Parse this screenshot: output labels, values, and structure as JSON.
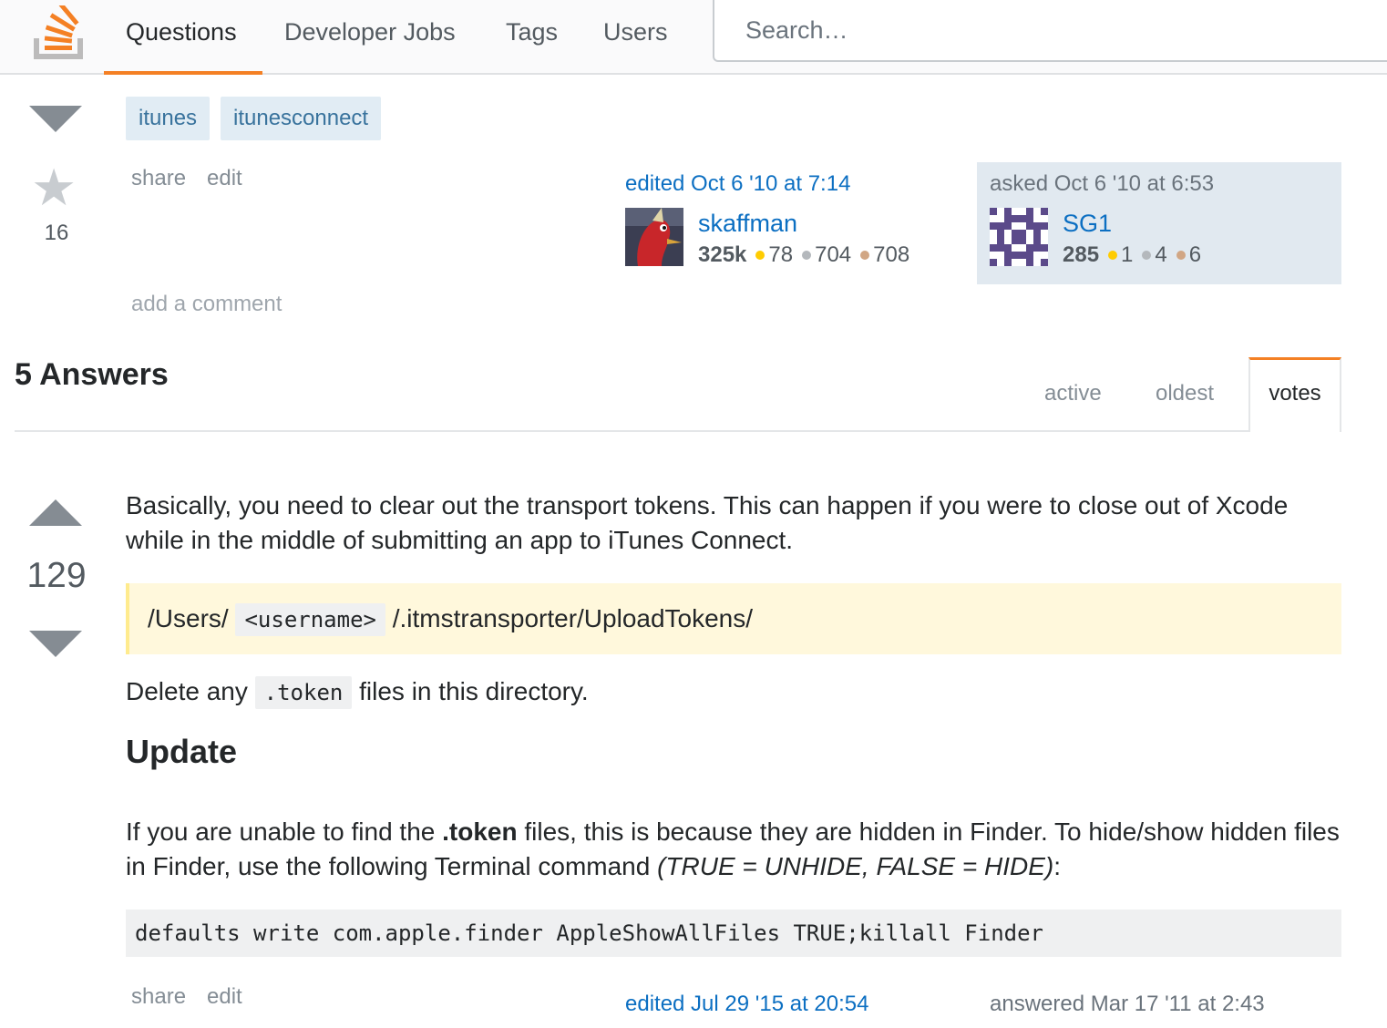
{
  "nav": {
    "items": [
      "Questions",
      "Developer Jobs",
      "Tags",
      "Users"
    ],
    "search_placeholder": "Search…"
  },
  "question": {
    "tags": [
      "itunes",
      "itunesconnect"
    ],
    "favorite_count": "16",
    "menu": {
      "share": "share",
      "edit": "edit"
    },
    "editor": {
      "action": "edited Oct 6 '10 at 7:14",
      "name": "skaffman",
      "reputation": "325k",
      "gold": "78",
      "silver": "704",
      "bronze": "708"
    },
    "owner": {
      "action": "asked Oct 6 '10 at 6:53",
      "name": "SG1",
      "reputation": "285",
      "gold": "1",
      "silver": "4",
      "bronze": "6"
    },
    "add_comment": "add a comment"
  },
  "answers_header": {
    "title": "5 Answers",
    "tabs": [
      "active",
      "oldest",
      "votes"
    ]
  },
  "answer": {
    "vote_count": "129",
    "intro": "Basically, you need to clear out the transport tokens. This can happen if you were to close out of Xcode while in the middle of submitting an app to iTunes Connect.",
    "path_prefix": "/Users/",
    "path_code": "<username>",
    "path_suffix": "/.itmstransporter/UploadTokens/",
    "delete_prefix": "Delete any",
    "delete_code": ".token",
    "delete_suffix": "files in this directory.",
    "update_heading": "Update",
    "update_p1": "If you are unable to find the",
    "update_bold": ".token",
    "update_p2": "files, this is because they are hidden in Finder. To hide/show hidden files in Finder, use the following Terminal command",
    "update_italic": "(TRUE = UNHIDE, FALSE = HIDE)",
    "update_end": ":",
    "command": "defaults write com.apple.finder AppleShowAllFiles TRUE;killall Finder",
    "menu": {
      "share": "share",
      "edit": "edit"
    },
    "edited": "edited Jul 29 '15 at 20:54",
    "answered": "answered Mar 17 '11 at 2:43"
  }
}
